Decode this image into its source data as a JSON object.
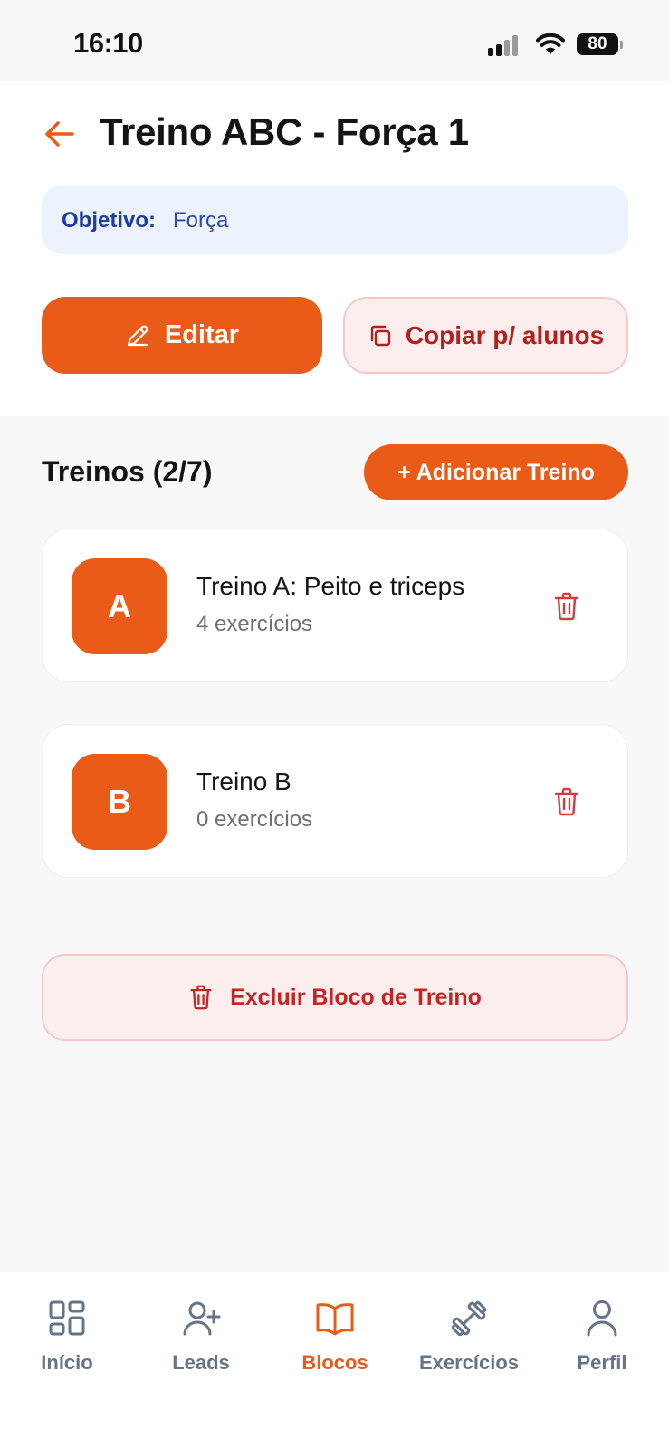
{
  "status_bar": {
    "time": "16:10",
    "battery": "80"
  },
  "header": {
    "title": "Treino ABC - Força 1"
  },
  "objective": {
    "label": "Objetivo:",
    "value": "Força"
  },
  "actions": {
    "edit_label": "Editar",
    "copy_label": "Copiar p/ alunos"
  },
  "workouts": {
    "title": "Treinos (2/7)",
    "add_label": "+ Adicionar Treino",
    "items": [
      {
        "letter": "A",
        "name": "Treino A: Peito e triceps",
        "count": "4 exercícios"
      },
      {
        "letter": "B",
        "name": "Treino B",
        "count": "0 exercícios"
      }
    ]
  },
  "delete_block_label": "Excluir Bloco de Treino",
  "nav": {
    "items": [
      {
        "label": "Início",
        "icon": "grid-icon",
        "active": false
      },
      {
        "label": "Leads",
        "icon": "user-plus-icon",
        "active": false
      },
      {
        "label": "Blocos",
        "icon": "book-open-icon",
        "active": true
      },
      {
        "label": "Exercícios",
        "icon": "dumbbell-icon",
        "active": false
      },
      {
        "label": "Perfil",
        "icon": "user-icon",
        "active": false
      }
    ]
  },
  "colors": {
    "accent": "#ea5b17",
    "danger": "#c42424",
    "objective_bg": "#ecf3fe",
    "nav_inactive": "#64748b"
  }
}
